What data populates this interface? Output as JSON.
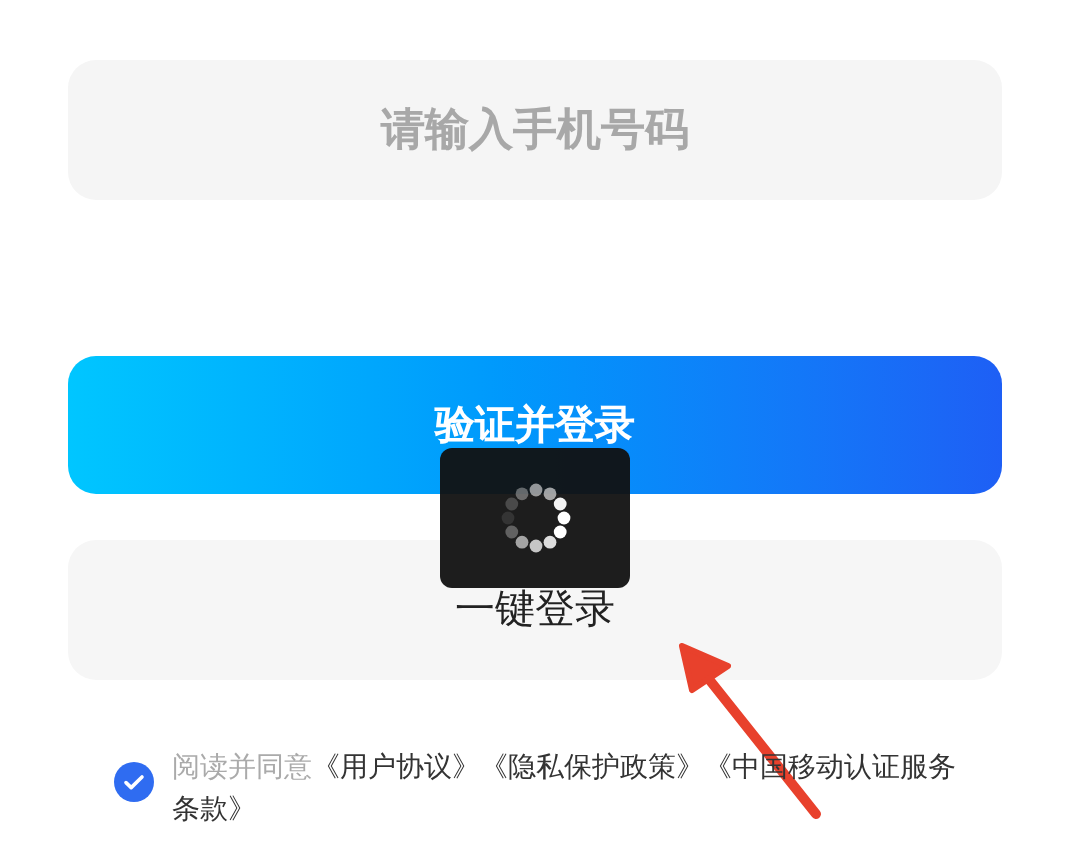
{
  "phone_field": {
    "placeholder": "请输入手机号码"
  },
  "verify_button": {
    "label": "验证并登录"
  },
  "one_tap_button": {
    "label": "一键登录"
  },
  "loading": {
    "visible": true
  },
  "agreement": {
    "checked": true,
    "prefix": "阅读并同意",
    "links": [
      "《用户协议》",
      "《隐私保护政策》",
      "《中国移动认证服务条款》"
    ]
  },
  "annotation": {
    "kind": "arrow"
  }
}
